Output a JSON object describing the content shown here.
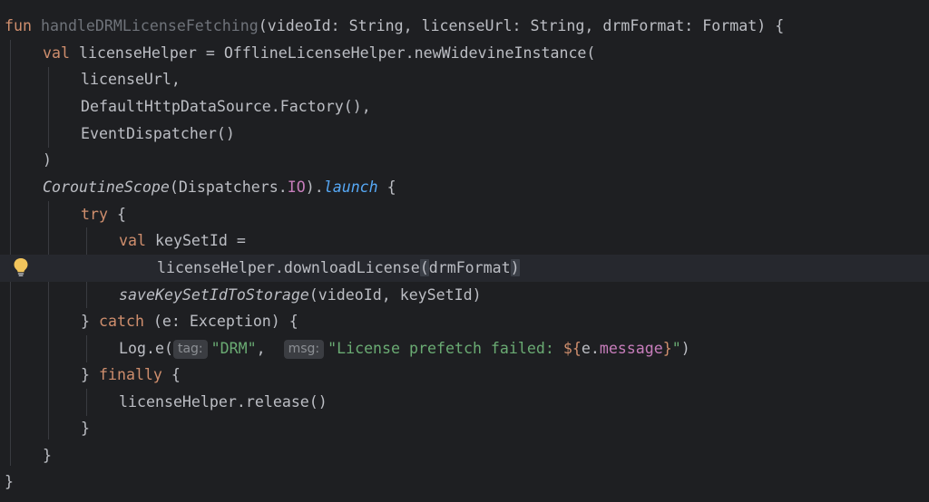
{
  "editor": {
    "lines": [
      {
        "id": "l1",
        "parts": [
          {
            "t": "fun ",
            "c": "kw"
          },
          {
            "t": "handleDRMLicenseFetching",
            "c": "fn-dim"
          },
          {
            "t": "(videoId: String, licenseUrl: String, drmFormat: Format) {",
            "c": ""
          }
        ]
      },
      {
        "id": "l2",
        "parts": [
          {
            "t": "val ",
            "c": "kw"
          },
          {
            "t": "licenseHelper = OfflineLicenseHelper.newWidevineInstance(",
            "c": ""
          }
        ]
      },
      {
        "id": "l3",
        "parts": [
          {
            "t": "licenseUrl,",
            "c": ""
          }
        ]
      },
      {
        "id": "l4",
        "parts": [
          {
            "t": "DefaultHttpDataSource.Factory(),",
            "c": ""
          }
        ]
      },
      {
        "id": "l5",
        "parts": [
          {
            "t": "EventDispatcher()",
            "c": ""
          }
        ]
      },
      {
        "id": "l6",
        "parts": [
          {
            "t": ")",
            "c": ""
          }
        ]
      },
      {
        "id": "l7",
        "parts": [
          {
            "t": "CoroutineScope",
            "c": "italic"
          },
          {
            "t": "(Dispatchers.",
            "c": ""
          },
          {
            "t": "IO",
            "c": "prop"
          },
          {
            "t": ").",
            "c": ""
          },
          {
            "t": "launch",
            "c": "fn italic"
          },
          {
            "t": " {",
            "c": ""
          }
        ]
      },
      {
        "id": "l8",
        "parts": [
          {
            "t": "try",
            "c": "kw"
          },
          {
            "t": " {",
            "c": ""
          }
        ]
      },
      {
        "id": "l9",
        "parts": [
          {
            "t": "val ",
            "c": "kw"
          },
          {
            "t": "keySetId =",
            "c": ""
          }
        ]
      },
      {
        "id": "l10",
        "parts": [
          {
            "t": "licenseHelper.downloadLicense",
            "c": ""
          },
          {
            "t": "(",
            "c": "bracket-hl"
          },
          {
            "t": "drmFormat",
            "c": ""
          },
          {
            "t": ")",
            "c": "bracket-hl"
          }
        ]
      },
      {
        "id": "l11",
        "parts": [
          {
            "t": "saveKeySetIdToStorage",
            "c": "italic"
          },
          {
            "t": "(videoId, keySetId)",
            "c": ""
          }
        ]
      },
      {
        "id": "l12",
        "parts": [
          {
            "t": "} ",
            "c": ""
          },
          {
            "t": "catch",
            "c": "kw"
          },
          {
            "t": " (e: Exception) {",
            "c": ""
          }
        ]
      },
      {
        "id": "l13",
        "parts": [
          {
            "t": "Log.e(",
            "c": ""
          },
          {
            "t": "tag:",
            "c": "hint"
          },
          {
            "t": "\"DRM\"",
            "c": "str"
          },
          {
            "t": ",  ",
            "c": ""
          },
          {
            "t": "msg:",
            "c": "hint"
          },
          {
            "t": "\"License prefetch failed: ",
            "c": "str"
          },
          {
            "t": "${",
            "c": "tmpl-dollar"
          },
          {
            "t": "e.",
            "c": ""
          },
          {
            "t": "message",
            "c": "prop"
          },
          {
            "t": "}",
            "c": "tmpl-dollar"
          },
          {
            "t": "\"",
            "c": "str"
          },
          {
            "t": ")",
            "c": ""
          }
        ]
      },
      {
        "id": "l14",
        "parts": [
          {
            "t": "} ",
            "c": ""
          },
          {
            "t": "finally",
            "c": "kw"
          },
          {
            "t": " {",
            "c": ""
          }
        ]
      },
      {
        "id": "l15",
        "parts": [
          {
            "t": "licenseHelper.release()",
            "c": ""
          }
        ]
      },
      {
        "id": "l16",
        "parts": [
          {
            "t": "}",
            "c": ""
          }
        ]
      },
      {
        "id": "l17",
        "parts": [
          {
            "t": "}",
            "c": ""
          }
        ]
      },
      {
        "id": "l18",
        "parts": [
          {
            "t": "}",
            "c": ""
          }
        ]
      }
    ],
    "gutter_icon": "lightbulb-icon",
    "colors": {
      "background": "#1e1f22",
      "keyword": "#cf8e6d",
      "string": "#6aab73",
      "function_call": "#56a8f5",
      "property": "#c77dbb",
      "unused_function": "#6f737a",
      "text": "#bcbec4",
      "lightbulb": "#f2c55c"
    }
  }
}
